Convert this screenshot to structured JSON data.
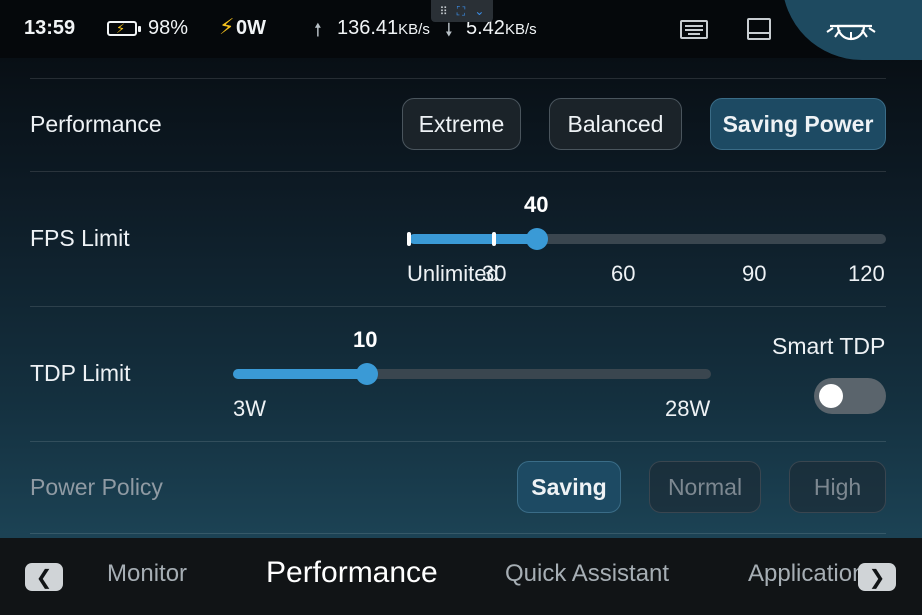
{
  "status_bar": {
    "time": "13:59",
    "battery_percent": "98%",
    "power_draw": "0W",
    "upload_value": "136.41",
    "upload_unit": "KB/s",
    "download_value": "5.42",
    "download_unit": "KB/s"
  },
  "performance": {
    "label": "Performance",
    "modes": [
      {
        "label": "Extreme",
        "selected": false
      },
      {
        "label": "Balanced",
        "selected": false
      },
      {
        "label": "Saving Power",
        "selected": true
      }
    ]
  },
  "fps_limit": {
    "label": "FPS Limit",
    "value": "40",
    "scale": [
      "Unlimited",
      "30",
      "60",
      "90",
      "120"
    ]
  },
  "tdp_limit": {
    "label": "TDP Limit",
    "value": "10",
    "min_label": "3W",
    "max_label": "28W"
  },
  "smart_tdp": {
    "label": "Smart TDP",
    "enabled": false
  },
  "power_policy": {
    "label": "Power Policy",
    "options": [
      {
        "label": "Saving",
        "selected": true
      },
      {
        "label": "Normal",
        "selected": false
      },
      {
        "label": "High",
        "selected": false
      }
    ]
  },
  "bottom_nav": {
    "items": [
      {
        "label": "Monitor",
        "active": false
      },
      {
        "label": "Performance",
        "active": true
      },
      {
        "label": "Quick Assistant",
        "active": false
      },
      {
        "label": "Applications",
        "active": false
      }
    ]
  },
  "icons": {
    "battery": "battery-charging-icon",
    "power": "lightning-icon",
    "upload": "arrow-up-icon",
    "download": "arrow-down-icon",
    "keyboard": "keyboard-icon",
    "tablet": "tablet-icon",
    "brightness": "brightness-icon",
    "prev": "chevron-left-icon",
    "next": "chevron-right-icon"
  },
  "colors": {
    "accent": "#3a9ad6",
    "active_button": "#1d4a63",
    "bolt": "#f6c21d"
  }
}
